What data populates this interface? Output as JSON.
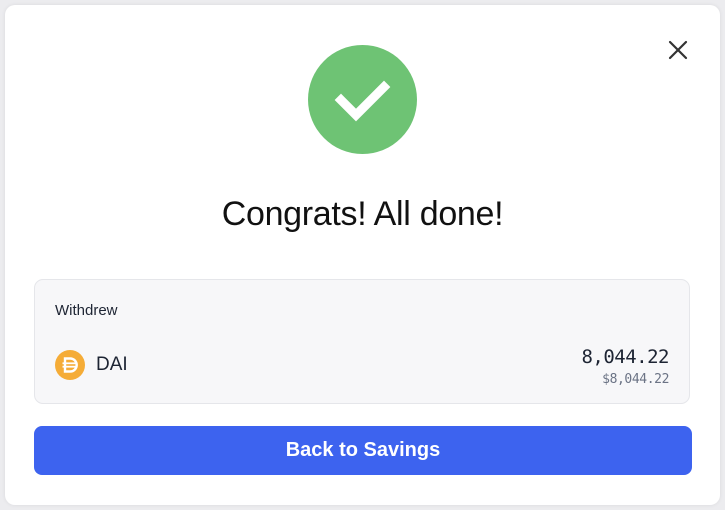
{
  "modal": {
    "title": "Congrats! All done!",
    "close_icon": "close-icon",
    "success_icon": "checkmark-icon",
    "success_color": "#6ec374"
  },
  "summary": {
    "label": "Withdrew",
    "token": {
      "icon": "dai-token-icon",
      "icon_color": "#f5ac37",
      "name": "DAI",
      "amount": "8,044.22",
      "amount_usd": "$8,044.22"
    }
  },
  "actions": {
    "primary_label": "Back to Savings",
    "primary_color": "#3d63ef"
  }
}
